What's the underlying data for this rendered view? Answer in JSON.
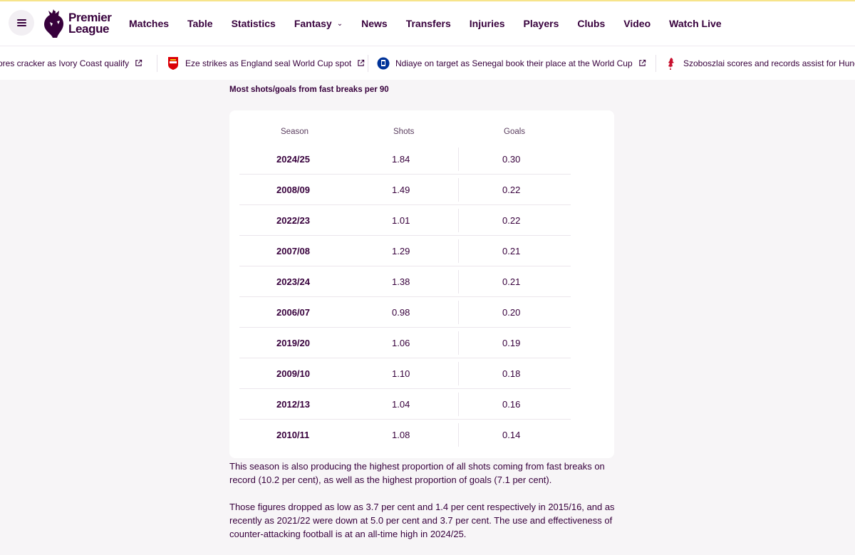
{
  "header": {
    "logo_line1": "Premier",
    "logo_line2": "League",
    "nav": [
      {
        "label": "Matches"
      },
      {
        "label": "Table"
      },
      {
        "label": "Statistics"
      },
      {
        "label": "Fantasy",
        "has_dropdown": true
      },
      {
        "label": "News"
      },
      {
        "label": "Transfers"
      },
      {
        "label": "Injuries"
      },
      {
        "label": "Players"
      },
      {
        "label": "Clubs"
      },
      {
        "label": "Video"
      },
      {
        "label": "Watch Live"
      }
    ]
  },
  "ticker": [
    {
      "text": "ores cracker as Ivory Coast qualify",
      "crest": "none"
    },
    {
      "text": "Eze strikes as England seal World Cup spot",
      "crest": "arsenal-crest-icon"
    },
    {
      "text": "Ndiaye on target as Senegal book their place at the World Cup",
      "crest": "everton-crest-icon"
    },
    {
      "text": "Szoboszlai scores and records assist for Hungary",
      "crest": "liverpool-crest-icon"
    }
  ],
  "table": {
    "title": "Most shots/goals from fast breaks per 90",
    "columns": [
      "Season",
      "Shots",
      "Goals"
    ],
    "rows": [
      [
        "2024/25",
        "1.84",
        "0.30"
      ],
      [
        "2008/09",
        "1.49",
        "0.22"
      ],
      [
        "2022/23",
        "1.01",
        "0.22"
      ],
      [
        "2007/08",
        "1.29",
        "0.21"
      ],
      [
        "2023/24",
        "1.38",
        "0.21"
      ],
      [
        "2006/07",
        "0.98",
        "0.20"
      ],
      [
        "2019/20",
        "1.06",
        "0.19"
      ],
      [
        "2009/10",
        "1.10",
        "0.18"
      ],
      [
        "2012/13",
        "1.04",
        "0.16"
      ],
      [
        "2010/11",
        "1.08",
        "0.14"
      ]
    ]
  },
  "paragraphs": [
    "This season is also producing the highest proportion of all shots coming from fast breaks on record (10.2 per cent), as well as the highest proportion of goals (7.1 per cent).",
    "Those figures dropped as low as 3.7 per cent and 1.4 per cent respectively in 2015/16, and as recently as 2021/22 were down at 5.0 per cent and 3.7 per cent. The use and effectiveness of counter-attacking football is at an all-time high in 2024/25."
  ],
  "colors": {
    "brand": "#37003c",
    "accent_line": "#f7e48a",
    "arsenal": "#db0007",
    "everton": "#003399",
    "liverpool": "#c8102e"
  }
}
